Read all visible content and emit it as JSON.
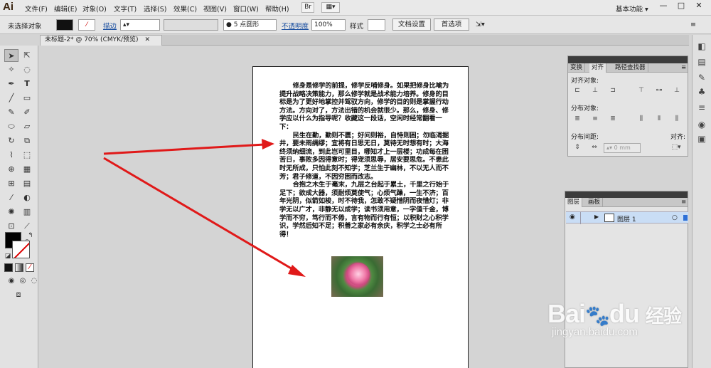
{
  "menubar": {
    "logo": "Ai",
    "items": [
      "文件(F)",
      "编辑(E)",
      "对象(O)",
      "文字(T)",
      "选择(S)",
      "效果(C)",
      "视图(V)",
      "窗口(W)",
      "帮助(H)"
    ],
    "workspace": "基本功能",
    "workspace_arrow": "▾",
    "window_controls": [
      "—",
      "□",
      "✕"
    ]
  },
  "control_bar": {
    "selection_status": "未选择对象",
    "stroke_label": "描边",
    "brush_label": "5 点圆形",
    "opacity_label": "不透明度",
    "opacity_value": "100%",
    "style_label": "样式",
    "doc_setup_button": "文档设置",
    "preferences_button": "首选项"
  },
  "document_tab": {
    "title": "未标题-2* @ 70% (CMYK/预览)",
    "close": "✕"
  },
  "artboard": {
    "paragraphs": [
      "修身是修学的前提，修学反哺修身。如果把修身比喻为提升战略决策能力，那么修学就是战术能力培养。修身的目标是为了更好地掌控并驾驭方向，修学的目的则是掌握行动方法。方向对了，方法出错的机会就很少。那么，修身、修学应以什么为指导呢？收藏这一段话，空闲时经常翻看一下：",
      "民生在勤，勤则不匮；好问则裕，自恃则困；勿临渴掘井，要未雨绸缪；宜将有日思无日，莫待无时想有时；大海终须纳细流，到此岂可里目，哪知才上一层楼；功成每在困苦日，事败多因得意时；得宠须思辱，居安要思危。不患此时无所成，只怕此刻不知学；芝兰生于幽林，不以无人而不芳；君子修道，不因穷困而改志。",
      "合抱之木生于毫末，九层之台起于累土，千里之行始于足下；欲成大器，须耐烦莫使气；心烦气躁，一生不济；百年光阴，似箭如梭，时不待我，怎敢不疑惜阴而夜惜灯；非学无以广才，非静无以成学；读书须用意，一字值千金，博学而不穷，笃行而不倦，言有物而行有恒；以积财之心积学识，学然后知不足；积善之家必有余庆，积学之士必有所得！"
    ]
  },
  "align_panel": {
    "tabs": [
      "变换",
      "对齐",
      "路径查找器"
    ],
    "align_objects_label": "对齐对象:",
    "distribute_objects_label": "分布对象:",
    "distribute_spacing_label": "分布间距:",
    "align_to_label": "对齐:",
    "spacing_value": "0 mm"
  },
  "layers_panel": {
    "tabs": [
      "图层",
      "画板"
    ],
    "layer_name": "图层 1"
  },
  "watermark": {
    "brand": "Bai",
    "brand2": "du",
    "cn": "经验",
    "url": "jingyan.baidu.com"
  }
}
